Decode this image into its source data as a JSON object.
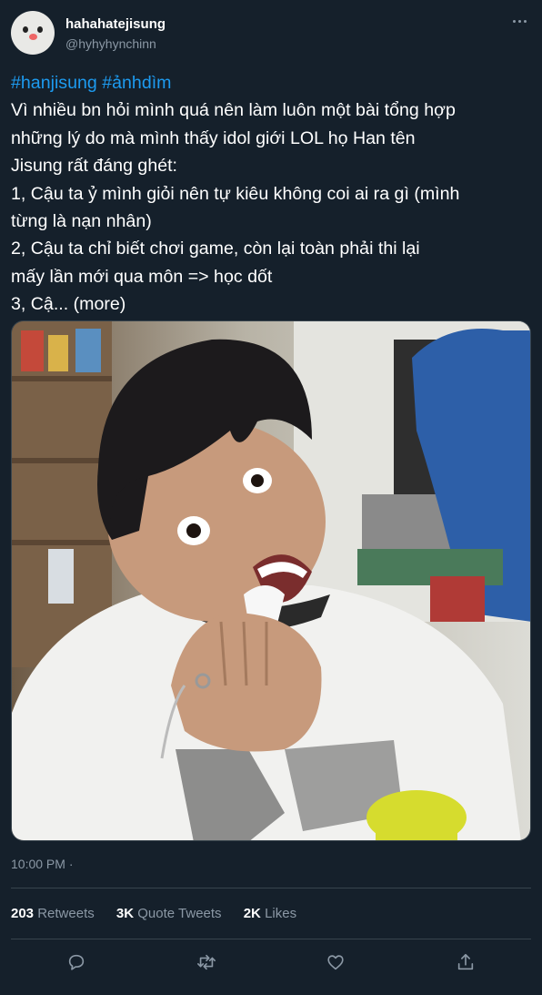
{
  "author": {
    "display_name": "hahahatejisung",
    "handle": "@hyhyhynchinn",
    "avatar_icon": "duck-avatar"
  },
  "tweet": {
    "hashtags": "#hanjisung #ảnhdìm",
    "lines": [
      "Vì nhiều bn hỏi mình quá nên làm luôn một bài tổng hợp",
      "những lý do mà mình thấy idol giới LOL họ Han tên",
      "Jisung rất đáng ghét:",
      "1, Cậu ta ỷ mình giỏi nên tự kiêu không coi ai ra gì (mình",
      "từng là nạn nhân)",
      "2, Cậu ta chỉ biết chơi game, còn lại toàn phải thi lại",
      "mấy lần mới qua môn => học dốt",
      "3, Cậ... (more)"
    ],
    "timestamp": "10:00 PM ·"
  },
  "stats": {
    "retweets_count": "203",
    "retweets_label": "Retweets",
    "quotes_count": "3K",
    "quotes_label": "Quote Tweets",
    "likes_count": "2K",
    "likes_label": "Likes"
  },
  "actions": [
    "reply-icon",
    "retweet-icon",
    "like-icon",
    "share-icon"
  ],
  "colors": {
    "background": "#15202b",
    "hashtag": "#1d9bf0",
    "secondary_text": "#8b98a5",
    "divider": "#38444d"
  }
}
